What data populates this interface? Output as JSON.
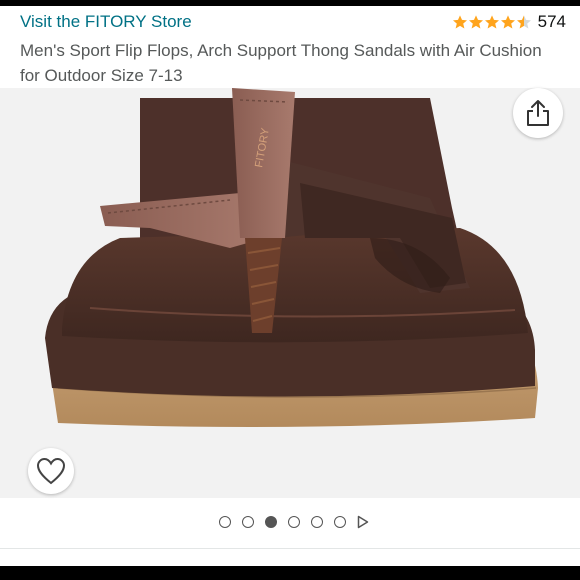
{
  "store": {
    "link_label": "Visit the FITORY Store"
  },
  "rating": {
    "stars": 4.5,
    "max_stars": 5,
    "review_count": "574"
  },
  "product": {
    "title": "Men's Sport Flip Flops, Arch Support Thong Sandals with Air Cushion for Outdoor Size 7-13",
    "strap_brand": "FITORY"
  },
  "gallery": {
    "image_count": 6,
    "active_index": 2,
    "has_next_arrow": true
  },
  "icons": {
    "share": "share-icon",
    "favorite": "heart-icon",
    "star": "star-icon",
    "next": "play-arrow-icon"
  },
  "colors": {
    "link": "#007185",
    "star": "#ffa41c",
    "star_empty": "#d5d9d9"
  }
}
